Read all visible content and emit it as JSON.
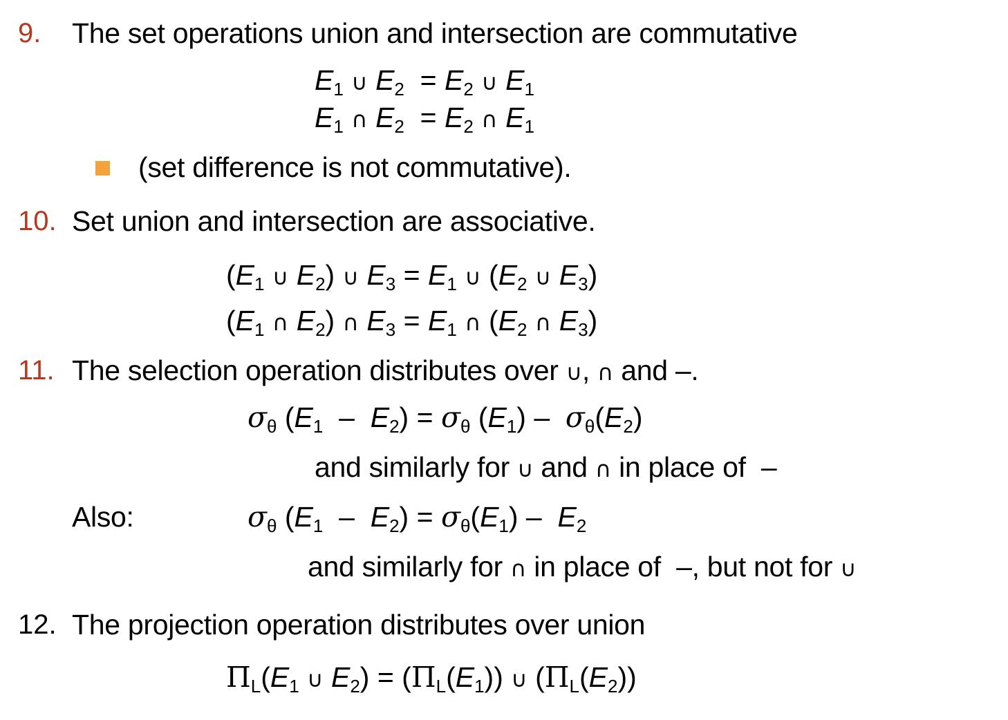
{
  "items": [
    {
      "number": "9.",
      "text": "The set operations union and intersection are commutative",
      "equations": [
        "E1 ∪ E2 = E2 ∪ E1",
        "E1 ∩ E2 = E2 ∩ E1"
      ],
      "sub_bullet": "(set difference is not commutative)."
    },
    {
      "number": "10.",
      "text": "Set union and intersection are associative.",
      "equations": [
        "(E1 ∪ E2) ∪ E3 = E1 ∪ (E2 ∪ E3)",
        "(E1 ∩ E2) ∩ E3 = E1 ∩ (E2 ∩ E3)"
      ]
    },
    {
      "number": "11.",
      "text": "The selection operation distributes over ∪, ∩ and –.",
      "equations": [
        "σθ (E1 – E2) = σθ (E1) – σθ(E2)",
        "σθ (E1 – E2) = σθ(E1) – E2"
      ],
      "note_1": "and similarly for ∪ and ∩ in place of –",
      "also_label": "Also:",
      "note_2": "and similarly for ∩ in place of –, but not for ∪"
    },
    {
      "number": "12.",
      "text": "The projection operation distributes over union",
      "equations": [
        "ΠL(E1 ∪ E2) = (ΠL(E1)) ∪ (ΠL(E2))"
      ]
    }
  ],
  "colors": {
    "number_accent": "#b5381f",
    "bullet": "#f4a23c",
    "text": "#000000"
  },
  "icons": {
    "sub_bullet": "square-bullet-icon"
  }
}
